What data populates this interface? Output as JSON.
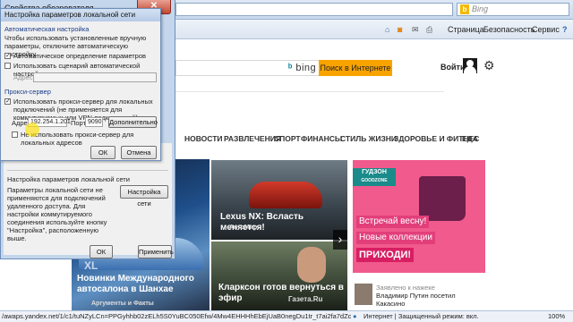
{
  "browser": {
    "address": "",
    "search_placeholder": "Bing",
    "search_icon": "b",
    "menu_fragment": "",
    "commands": {
      "page": "Страница",
      "safety": "Безопасность",
      "service": "Сервис",
      "help": "?"
    }
  },
  "page": {
    "bing_logo": "bing",
    "search_button": "Поиск в Интернете",
    "login": "Войти",
    "nav": [
      "НОВОСТИ",
      "РАЗВЛЕЧЕНИЯ",
      "СПОРТ",
      "ФИНАНСЫ",
      "СТИЛЬ ЖИЗНИ",
      "ЗДОРОВЬЕ И ФИТНЕС",
      "ЕДА"
    ],
    "tiles": {
      "lexus_caption": "Lexus NX: Всласть меняется!",
      "lexus_source": "АвтоМир",
      "clarkson_caption": "Кларксон готов вернуться в эфир",
      "clarkson_source": "Газета.Ru",
      "shanghai_caption": "Новинки Международного автосалона в Шанхае",
      "shanghai_source": "Аргументы и Факты",
      "next_arrow": "›",
      "ad_brand_1": "ГУДЗОН",
      "ad_brand_2": "GOODZONE",
      "ad_line_1": "Встречай весну!",
      "ad_line_2": "Новые коллекции",
      "ad_line_3": "ПРИХОДИ!",
      "news_line_1": "Заявлено к нажеке",
      "news_line_2": "Владимир Путин посетил",
      "news_line_3": "Какасино"
    }
  },
  "dialog_outer": {
    "title": "Свойства обозревателя",
    "close": "✕",
    "lan_group": "Настройка параметров локальной сети",
    "lan_text": "Параметры локальной сети не применяются для подключений удаленного доступа. Для настройки коммутируемого соединения используйте кнопку \"Настройка\", расположенную выше.",
    "lan_button": "Настройка сети",
    "ok": "ОК",
    "cancel": "Отмена",
    "apply": "Применить"
  },
  "dialog_inner": {
    "title": "Настройка параметров локальной сети",
    "auto_group": "Автоматическая настройка",
    "auto_text": "Чтобы использовать установленные вручную параметры, отключите автоматическую настройку.",
    "auto_detect": "Автоматическое определение параметров",
    "auto_script": "Использовать сценарий автоматической настройки",
    "address_label": "Адрес",
    "proxy_group": "Прокси-сервер",
    "proxy_use": "Использовать прокси-сервер для локальных подключений (не применяется для коммутируемых или VPN-подключений).",
    "proxy_address_label": "Адрес:",
    "proxy_address": "192.254.1.201",
    "port_label": "Порт:",
    "port": "9090",
    "advanced": "Дополнительно",
    "bypass_local": "Не использовать прокси-сервер для локальных адресов",
    "ok": "ОК",
    "cancel": "Отмена"
  },
  "status": {
    "url": "/awaps.yandex.net/1/c1/tuNZyLCn=PPGyhhb02zELh5S0YuBC050Efw/4Mw4EHHHhEbEjUaB0negDu1tr_t7ai2fa7dZcMG3w4Jt9hi",
    "zone": "Интернет | Защищенный режим: вкл.",
    "zoom": "100%"
  },
  "colors": {
    "accent": "#f8a300",
    "ad_pink": "#f05a8c",
    "ad_teal": "#1a8a8a"
  }
}
